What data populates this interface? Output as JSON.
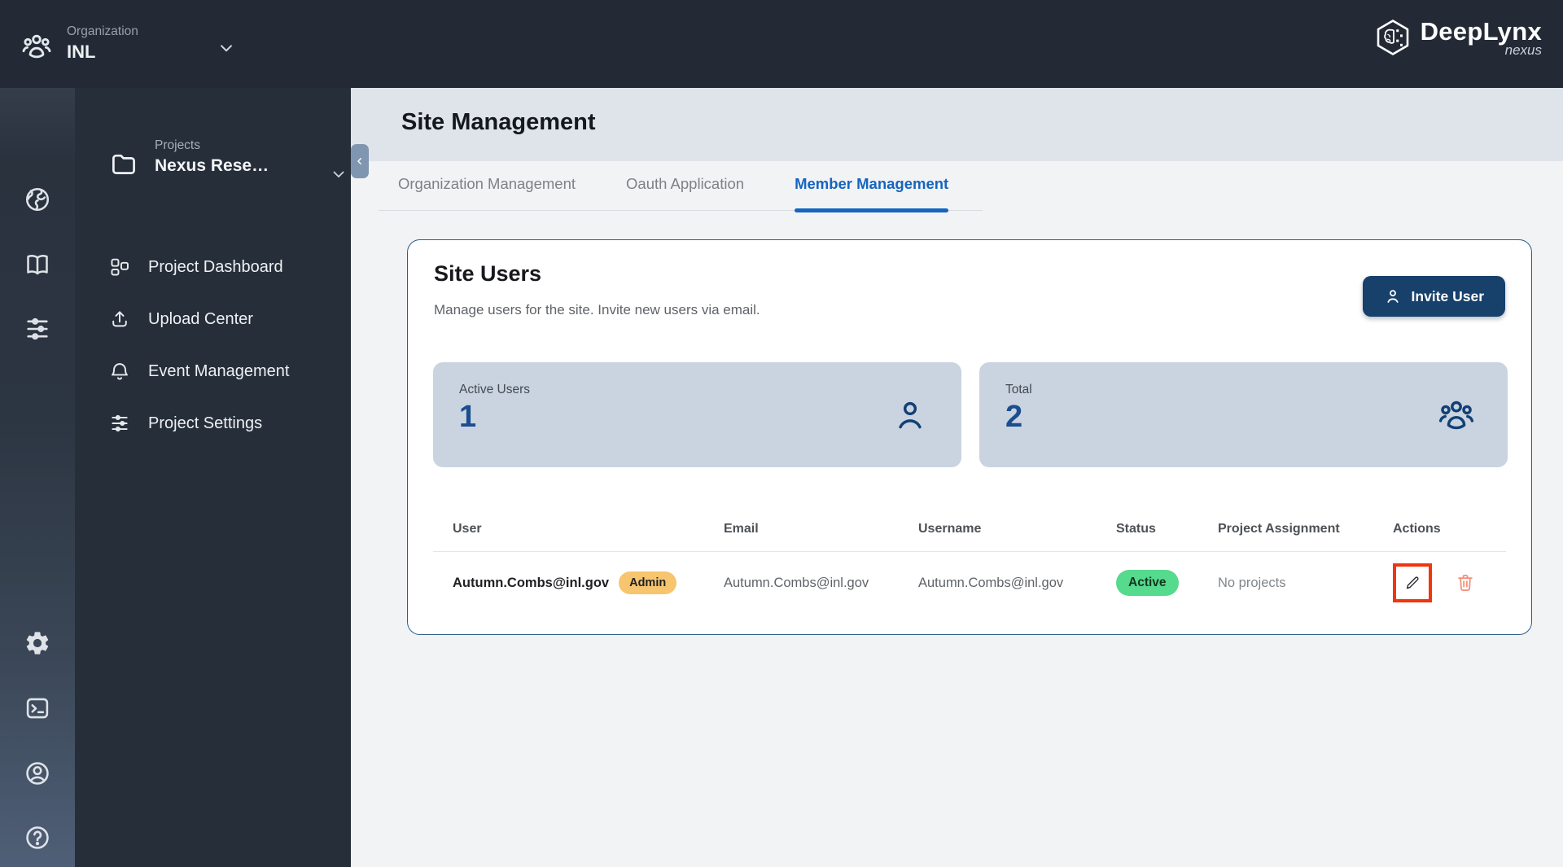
{
  "topbar": {
    "org_label": "Organization",
    "org_name": "INL",
    "brand": "DeepLynx",
    "brand_sub": "nexus"
  },
  "rail": {
    "icons": [
      "globe-icon",
      "book-icon",
      "sliders-icon",
      "gear-icon",
      "terminal-icon",
      "user-circle-icon",
      "help-icon"
    ]
  },
  "sidebar": {
    "section_label": "Projects",
    "project_name": "Nexus Rese…",
    "items": [
      {
        "label": "Project Dashboard",
        "icon": "dashboard-icon"
      },
      {
        "label": "Upload Center",
        "icon": "upload-icon"
      },
      {
        "label": "Event Management",
        "icon": "bell-icon"
      },
      {
        "label": "Project Settings",
        "icon": "sliders-icon"
      }
    ]
  },
  "page": {
    "title": "Site Management"
  },
  "tabs": [
    {
      "label": "Organization Management",
      "active": false
    },
    {
      "label": "Oauth Application",
      "active": false
    },
    {
      "label": "Member Management",
      "active": true
    }
  ],
  "card": {
    "title": "Site Users",
    "subtitle": "Manage users for the site. Invite new users via email.",
    "invite_button": "Invite User"
  },
  "stats": [
    {
      "label": "Active Users",
      "value": "1",
      "icon": "user-icon"
    },
    {
      "label": "Total",
      "value": "2",
      "icon": "users-icon"
    }
  ],
  "table": {
    "columns": [
      "User",
      "Email",
      "Username",
      "Status",
      "Project Assignment",
      "Actions"
    ],
    "rows": [
      {
        "user": "Autumn.Combs@inl.gov",
        "role_badge": "Admin",
        "email": "Autumn.Combs@inl.gov",
        "username": "Autumn.Combs@inl.gov",
        "status": "Active",
        "project_assignment": "No projects"
      }
    ]
  },
  "colors": {
    "topbar_bg": "#232a36",
    "sidebar_bg": "#262e39",
    "accent_blue": "#1565c0",
    "invite_navy": "#17406b",
    "stat_bg": "#c9d4e0",
    "stat_value": "#1b4d8f",
    "admin_badge_bg": "#f6c56d",
    "active_badge_bg": "#55da8e",
    "highlight_red": "#f1350f",
    "trash_red": "#f2917d",
    "header_band_bg": "#dfe4ea",
    "page_bg": "#f2f3f5",
    "card_border": "#2e5d85"
  }
}
